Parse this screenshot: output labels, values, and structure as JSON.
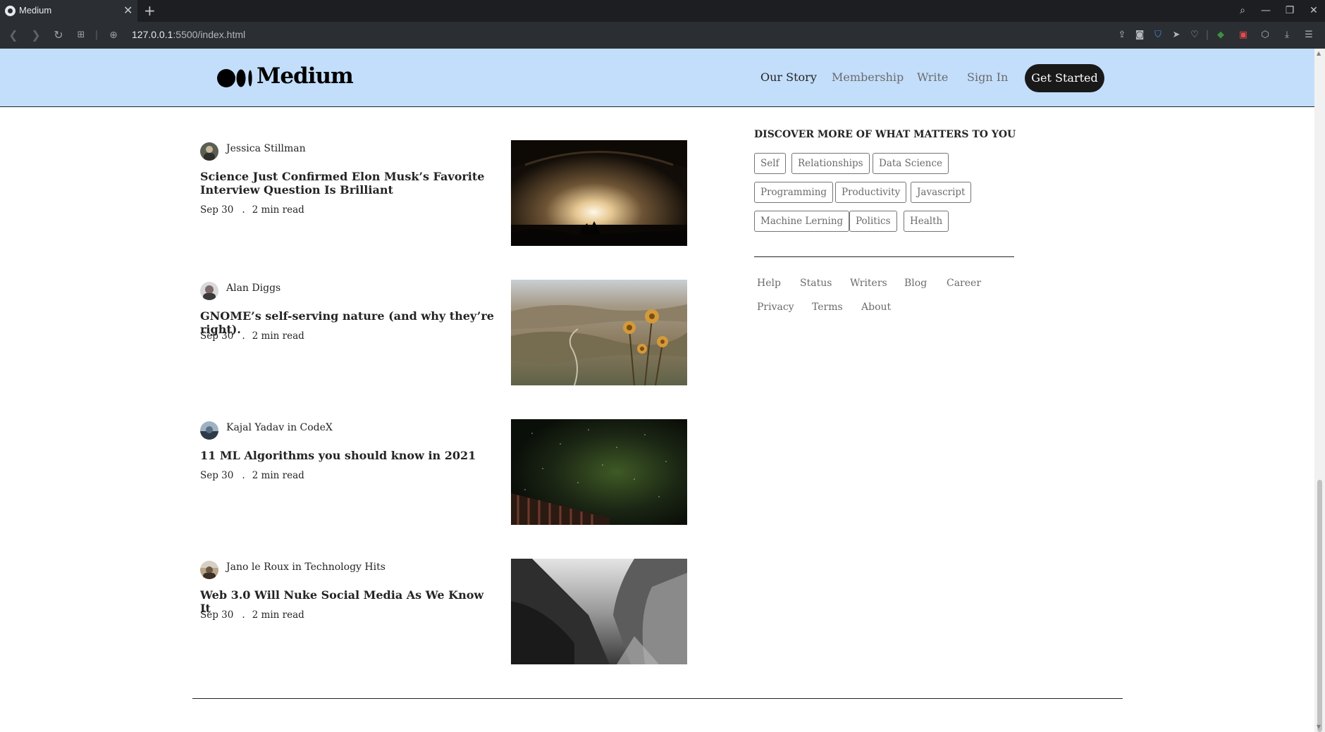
{
  "browser": {
    "tab_title": "Medium",
    "url_host": "127.0.0.1",
    "url_path": ":5500/index.html"
  },
  "header": {
    "logo_text": "Medium",
    "nav": [
      {
        "label": "Our Story"
      },
      {
        "label": "Membership"
      },
      {
        "label": "Write"
      },
      {
        "label": "Sign In"
      }
    ],
    "cta_label": "Get Started",
    "background": "#c3defb"
  },
  "articles": [
    {
      "author": "Jessica Stillman",
      "title": "Science Just Confirmed Elon Musk’s Favorite Interview Question Is Brilliant",
      "date": "Sep 30",
      "separator": ".",
      "read_time": "2 min read"
    },
    {
      "author": "Alan Diggs",
      "title": "GNOME’s self-serving nature (and why they’re right).",
      "date": "Sep 30",
      "separator": ".",
      "read_time": "2 min read"
    },
    {
      "author": "Kajal Yadav in CodeX",
      "title": "11 ML Algorithms you should know in 2021",
      "date": "Sep 30",
      "separator": ".",
      "read_time": "2 min read"
    },
    {
      "author": "Jano le Roux in Technology Hits",
      "title": "Web 3.0 Will Nuke Social Media As We Know It",
      "date": "Sep 30",
      "separator": ".",
      "read_time": "2 min read"
    }
  ],
  "sidebar": {
    "title": "DISCOVER MORE OF WHAT MATTERS TO YOU",
    "tags": [
      "Self",
      "Relationships",
      "Data Science",
      "Programming",
      "Productivity",
      "Javascript",
      "Machine Lerning",
      "Politics",
      "Health"
    ],
    "footer_links": [
      "Help",
      "Status",
      "Writers",
      "Blog",
      "Career",
      "Privacy",
      "Terms",
      "About"
    ]
  }
}
